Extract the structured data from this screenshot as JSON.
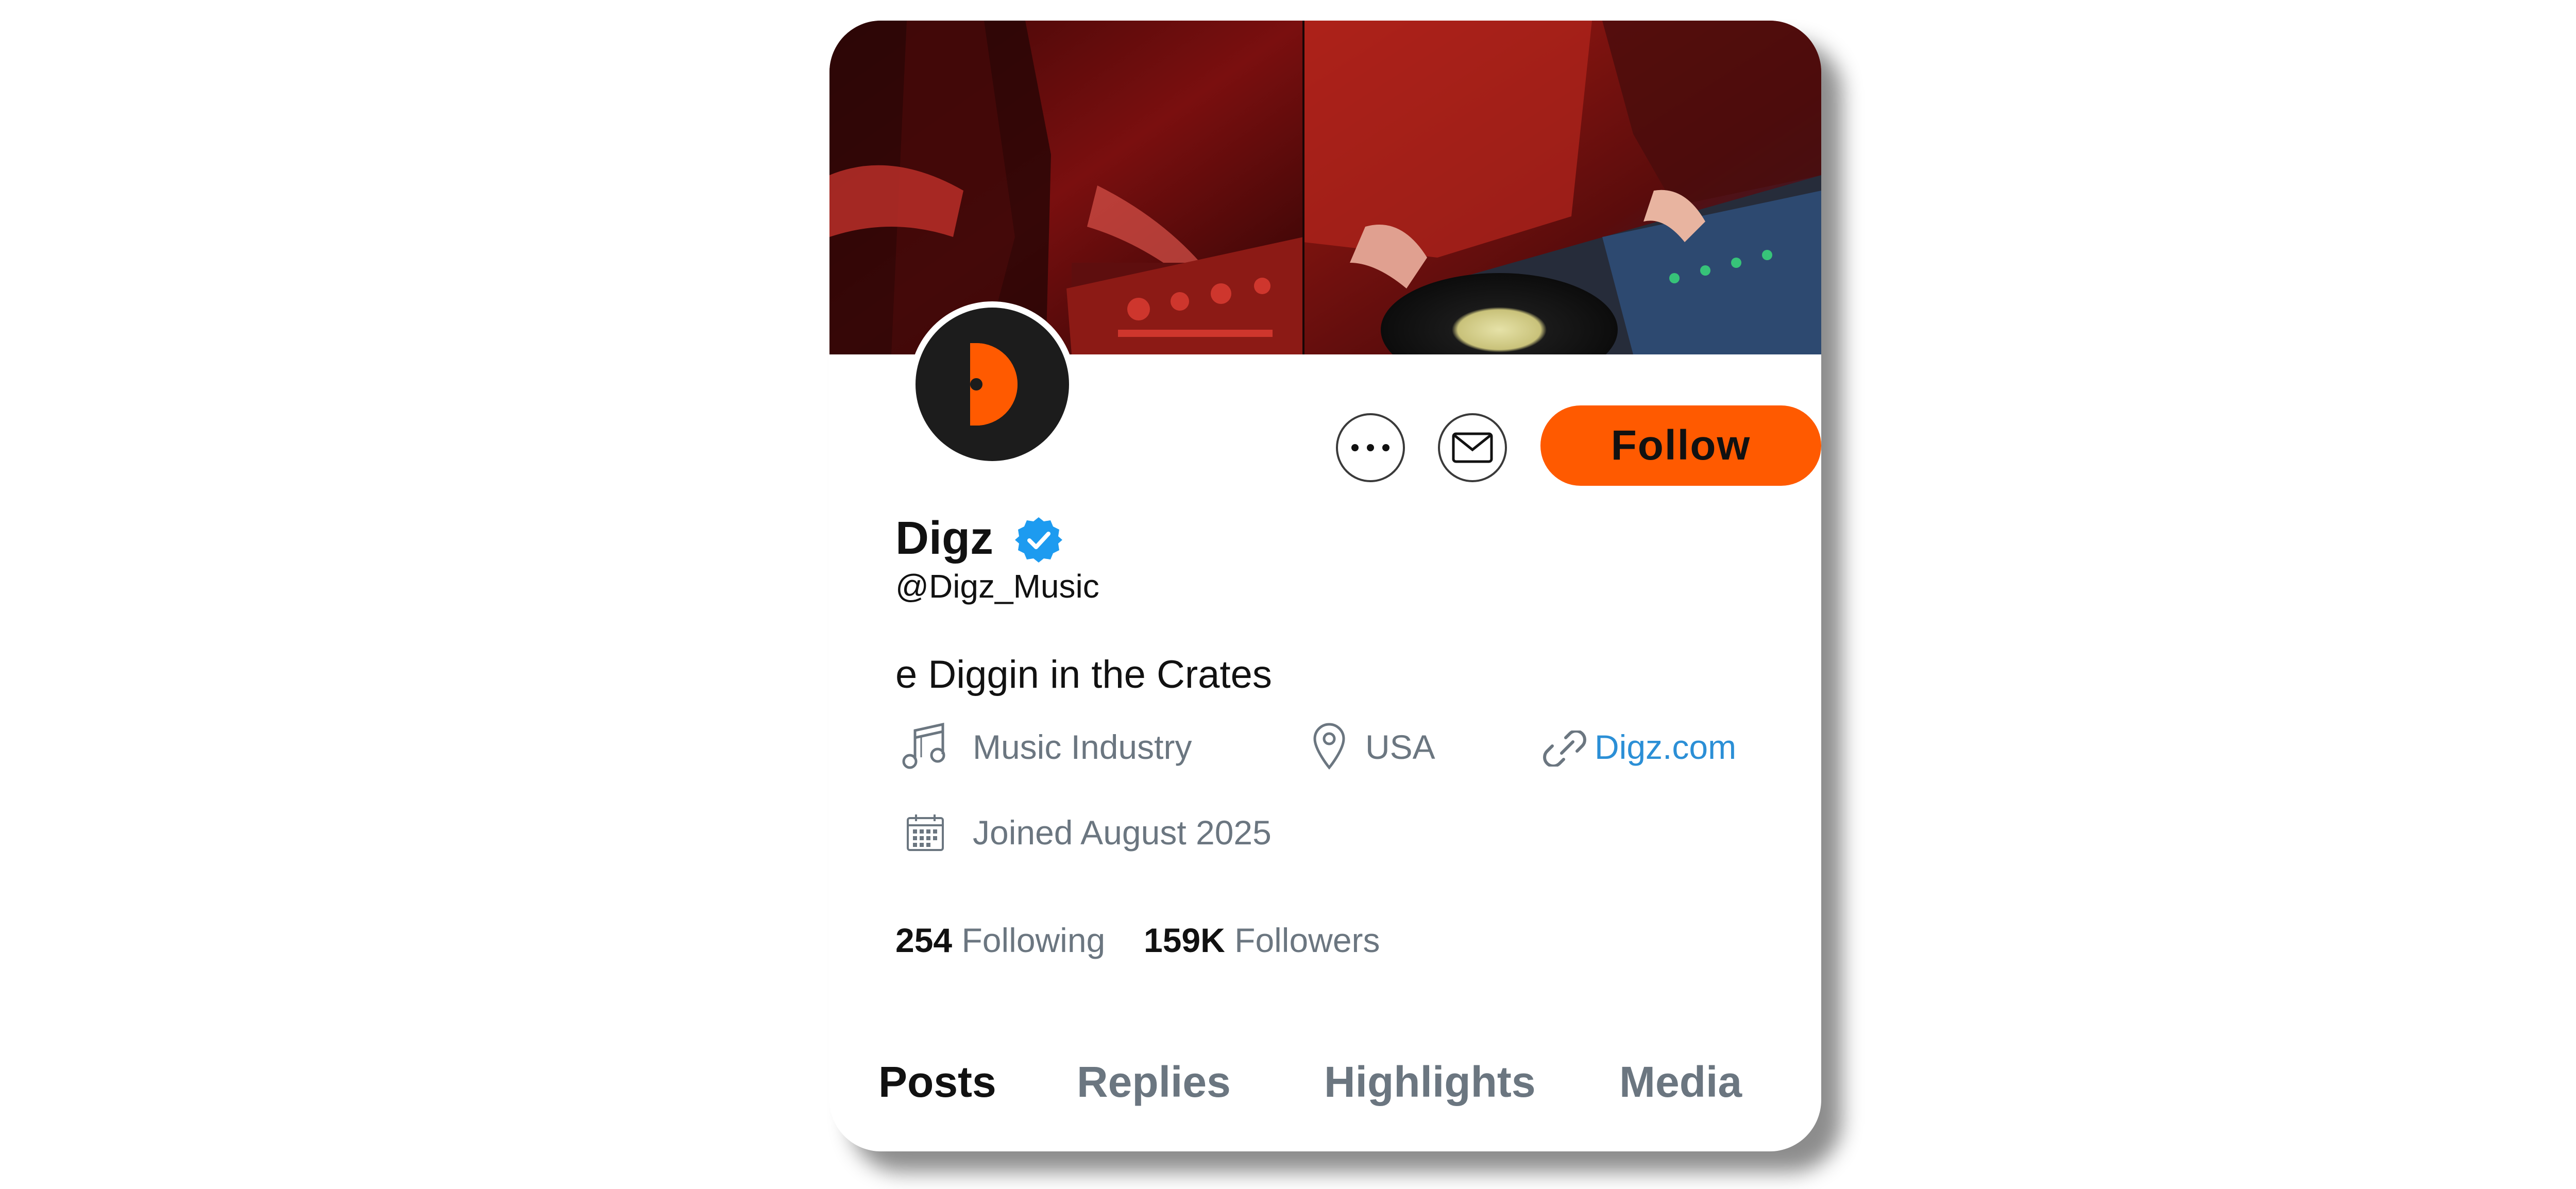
{
  "profile": {
    "name": "Digz",
    "handle": "@Digz_Music",
    "bio": "e Diggin in the Crates",
    "verified_icon": "verified-badge-icon"
  },
  "actions": {
    "more_icon": "more-horizontal-icon",
    "message_icon": "envelope-icon",
    "follow_label": "Follow"
  },
  "meta": {
    "category": "Music Industry",
    "location": "USA",
    "website": "Digz.com",
    "joined": "Joined August 2025"
  },
  "stats": {
    "following_count": "254",
    "following_label": "Following",
    "followers_count": "159K",
    "followers_label": "Followers"
  },
  "tabs": [
    {
      "label": "Posts"
    },
    {
      "label": "Replies"
    },
    {
      "label": "Highlights"
    },
    {
      "label": "Media"
    }
  ],
  "colors": {
    "accent": "#ff5a00",
    "verified": "#1d9bf0",
    "link": "#2b8fd6",
    "muted_text": "#6b7680"
  }
}
